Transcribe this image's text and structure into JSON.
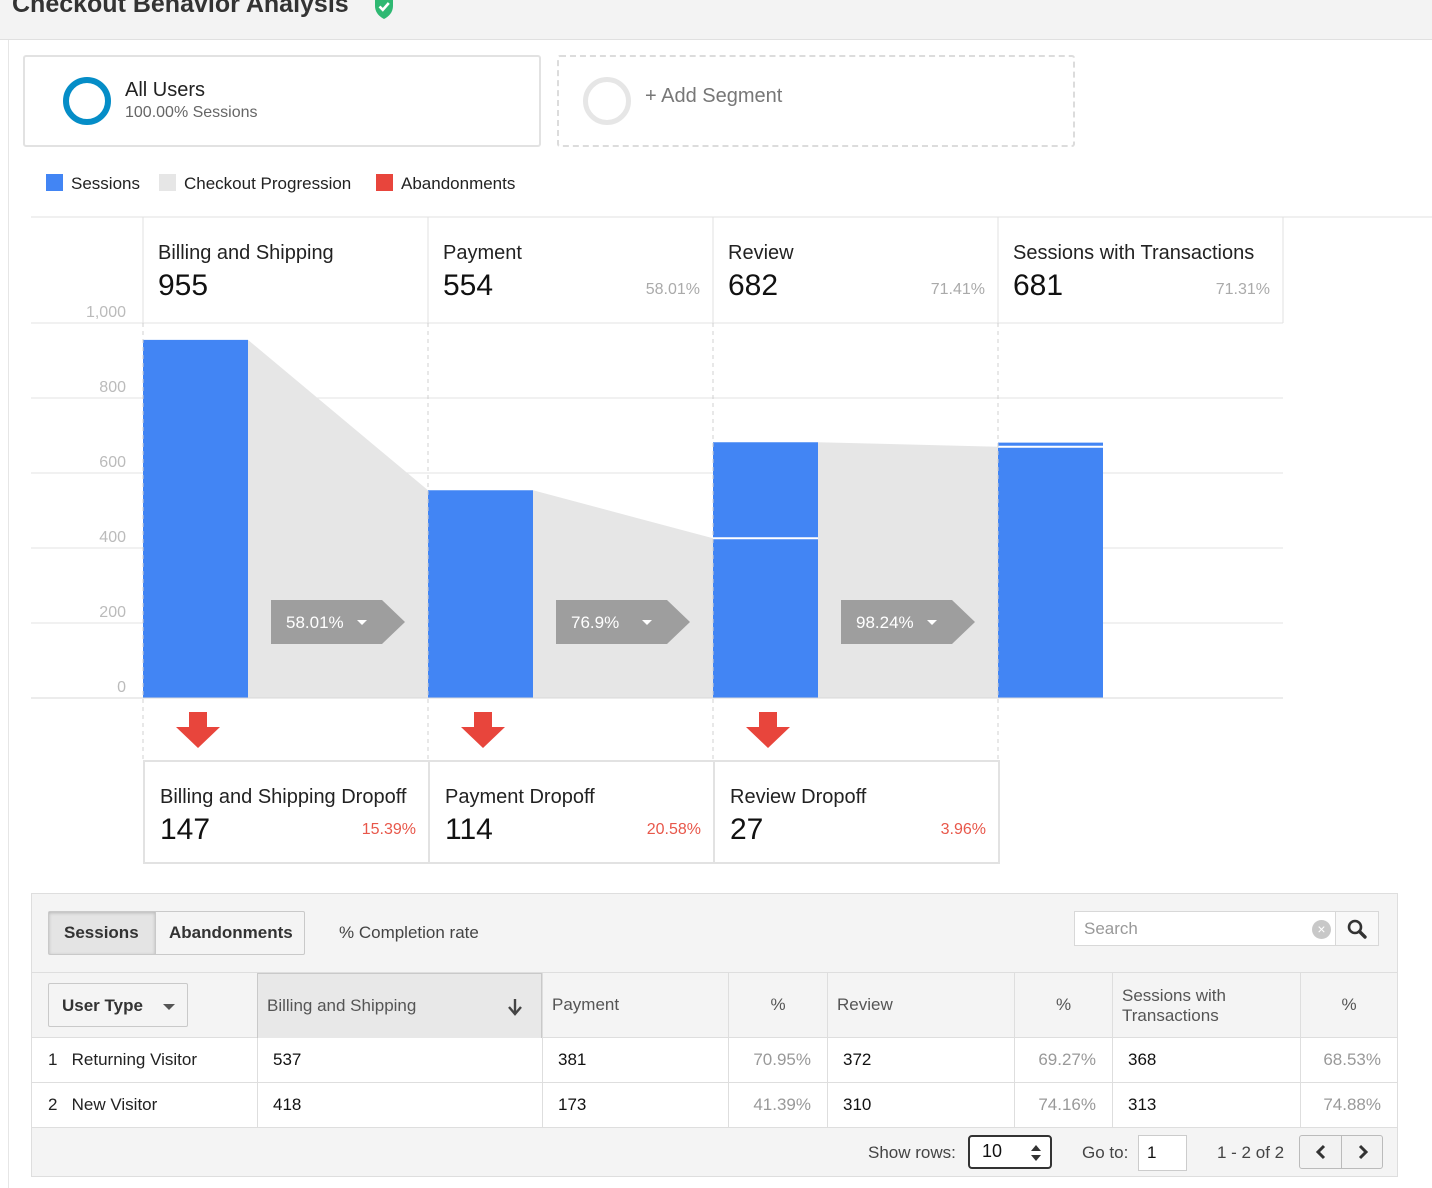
{
  "header": {
    "title": "Checkout Behavior Analysis"
  },
  "segments": {
    "all_users": {
      "title": "All Users",
      "subtitle": "100.00% Sessions"
    },
    "add_segment": "+ Add Segment"
  },
  "legend": [
    {
      "label": "Sessions",
      "color": "#4285f4"
    },
    {
      "label": "Checkout Progression",
      "color": "#e6e6e6"
    },
    {
      "label": "Abandonments",
      "color": "#e8453c"
    }
  ],
  "chart_data": {
    "type": "bar",
    "y_ticks": [
      "0",
      "200",
      "400",
      "600",
      "800",
      "1,000"
    ],
    "ylim": [
      0,
      1000
    ],
    "steps": [
      {
        "name": "Billing and Shipping",
        "value": "955",
        "sessions": 955,
        "carried_in": 0,
        "pct": ""
      },
      {
        "name": "Payment",
        "value": "554",
        "sessions": 554,
        "carried_in": 0,
        "pct": "58.01%"
      },
      {
        "name": "Review",
        "value": "682",
        "sessions": 682,
        "carried_in": 426,
        "pct": "71.41%"
      },
      {
        "name": "Sessions with Transactions",
        "value": "681",
        "sessions": 681,
        "carried_in": 670,
        "pct": "71.31%"
      }
    ],
    "progressions": [
      {
        "label": "58.01%",
        "from": 955,
        "to": 554
      },
      {
        "label": "76.9%",
        "from": 554,
        "to": 426
      },
      {
        "label": "98.24%",
        "from": 682,
        "to": 670
      }
    ],
    "dropoffs": [
      {
        "name": "Billing and Shipping Dropoff",
        "value": "147",
        "pct": "15.39%"
      },
      {
        "name": "Payment Dropoff",
        "value": "114",
        "pct": "20.58%"
      },
      {
        "name": "Review Dropoff",
        "value": "27",
        "pct": "3.96%"
      }
    ]
  },
  "table": {
    "tabs": [
      "Sessions",
      "Abandonments"
    ],
    "completion_label": "% Completion rate",
    "search_placeholder": "Search",
    "dimension_label": "User Type",
    "columns": {
      "billing": "Billing and Shipping",
      "payment": "Payment",
      "review": "Review",
      "transactions_1": "Sessions with",
      "transactions_2": "Transactions",
      "pct": "%"
    },
    "rows": [
      {
        "index": "1",
        "user_type": "Returning Visitor",
        "billing": "537",
        "payment": "381",
        "payment_pct": "70.95%",
        "review": "372",
        "review_pct": "69.27%",
        "transactions": "368",
        "transactions_pct": "68.53%"
      },
      {
        "index": "2",
        "user_type": "New Visitor",
        "billing": "418",
        "payment": "173",
        "payment_pct": "41.39%",
        "review": "310",
        "review_pct": "74.16%",
        "transactions": "313",
        "transactions_pct": "74.88%"
      }
    ],
    "footer": {
      "show_rows_label": "Show rows:",
      "show_rows_value": "10",
      "goto_label": "Go to:",
      "goto_value": "1",
      "range": "1 - 2 of 2"
    }
  }
}
